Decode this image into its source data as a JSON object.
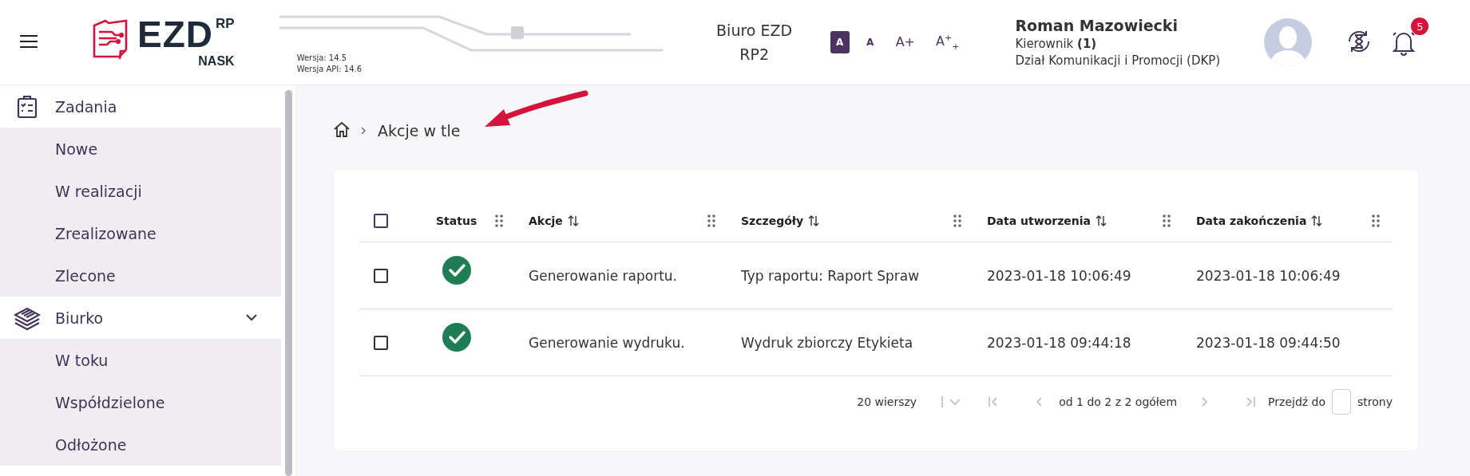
{
  "header": {
    "logo": {
      "brand": "EZD",
      "superscript": "RP",
      "subtitle": "NASK"
    },
    "versions": [
      "Wersja: 14.5",
      "Wersja API: 14.6"
    ],
    "office": "Biuro EZD RP2",
    "font_sizes": [
      {
        "label": "A",
        "selected": true
      },
      {
        "label": "A",
        "selected": false
      },
      {
        "label": "A+",
        "selected": false
      },
      {
        "label": "A$^{+}$$_{+}$",
        "selected": false
      }
    ],
    "user": {
      "name": "Roman Mazowiecki",
      "role": "Kierownik **(1)**",
      "department": "Dział Komunikacji i Promocji (DKP)"
    },
    "notifications": {
      "badge": "5"
    }
  },
  "sidebar": {
    "sections": [
      {
        "label": "Zadania",
        "children": [
          "Nowe",
          "W realizacji",
          "Zrealizowane",
          "Zlecone"
        ]
      },
      {
        "label": "Biurko",
        "expanded": true,
        "children": [
          "W toku",
          "Współdzielone",
          "Odłożone"
        ]
      }
    ]
  },
  "breadcrumb": [
    "Akcje w tle"
  ],
  "table": {
    "header_checked": false,
    "status_column": {
      "label": "Status"
    },
    "columns": [
      {
        "label": "Akcje",
        "sortable": true
      },
      {
        "label": "Szczegóły",
        "sortable": true
      },
      {
        "label": "Data utworzenia",
        "sortable": true
      },
      {
        "label": "Data zakończenia",
        "sortable": true
      }
    ],
    "rows": [
      {
        "checked": false,
        "success": true,
        "cells": [
          "Generowanie raportu.",
          "Typ raportu: Raport Spraw",
          "2023-01-18 10:06:49",
          "2023-01-18 10:06:49"
        ]
      },
      {
        "checked": false,
        "success": true,
        "cells": [
          "Generowanie wydruku.",
          "Wydruk zbiorczy Etykieta",
          "2023-01-18 09:44:18",
          "2023-01-18 09:44:50"
        ]
      }
    ]
  },
  "pagination": {
    "rows_per_page": "20 wierszy",
    "range": "od 1 do 2 z 2 ogółem",
    "goto_label": "Przejdź do",
    "goto_suffix": "strony"
  }
}
